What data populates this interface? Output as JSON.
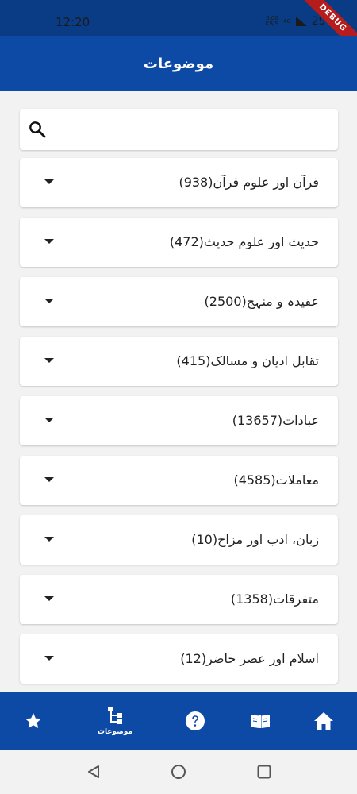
{
  "status_bar": {
    "time": "12:20",
    "net_speed_value": "5.00",
    "net_speed_unit": "KB/S",
    "network_type": "4G",
    "battery": "29%",
    "debug_label": "DEBUG"
  },
  "app_bar": {
    "title": "موضوعات"
  },
  "search": {
    "placeholder": "",
    "value": ""
  },
  "topics": [
    {
      "label": "قرآن اور علوم قرآن(938)"
    },
    {
      "label": "حدیث اور علوم حدیث(472)"
    },
    {
      "label": "عقیدہ و منہج(2500)"
    },
    {
      "label": "تقابل ادیان و مسالک(415)"
    },
    {
      "label": "عبادات(13657)"
    },
    {
      "label": "معاملات(4585)"
    },
    {
      "label": "زبان، ادب اور مزاح(10)"
    },
    {
      "label": "متفرقات(1358)"
    },
    {
      "label": "اسلام اور عصر حاضر(12)"
    }
  ],
  "bottom_nav": {
    "topics_label": "موضوعات",
    "icons": [
      "star-icon",
      "tree-icon",
      "help-icon",
      "book-icon",
      "home-icon"
    ],
    "colors": {
      "background": "#0d4aa6",
      "icon": "#ffffff"
    }
  },
  "colors": {
    "app_bar": "#0d4aa6",
    "status_bar": "#0a3c86",
    "debug": "#b71c1c"
  }
}
